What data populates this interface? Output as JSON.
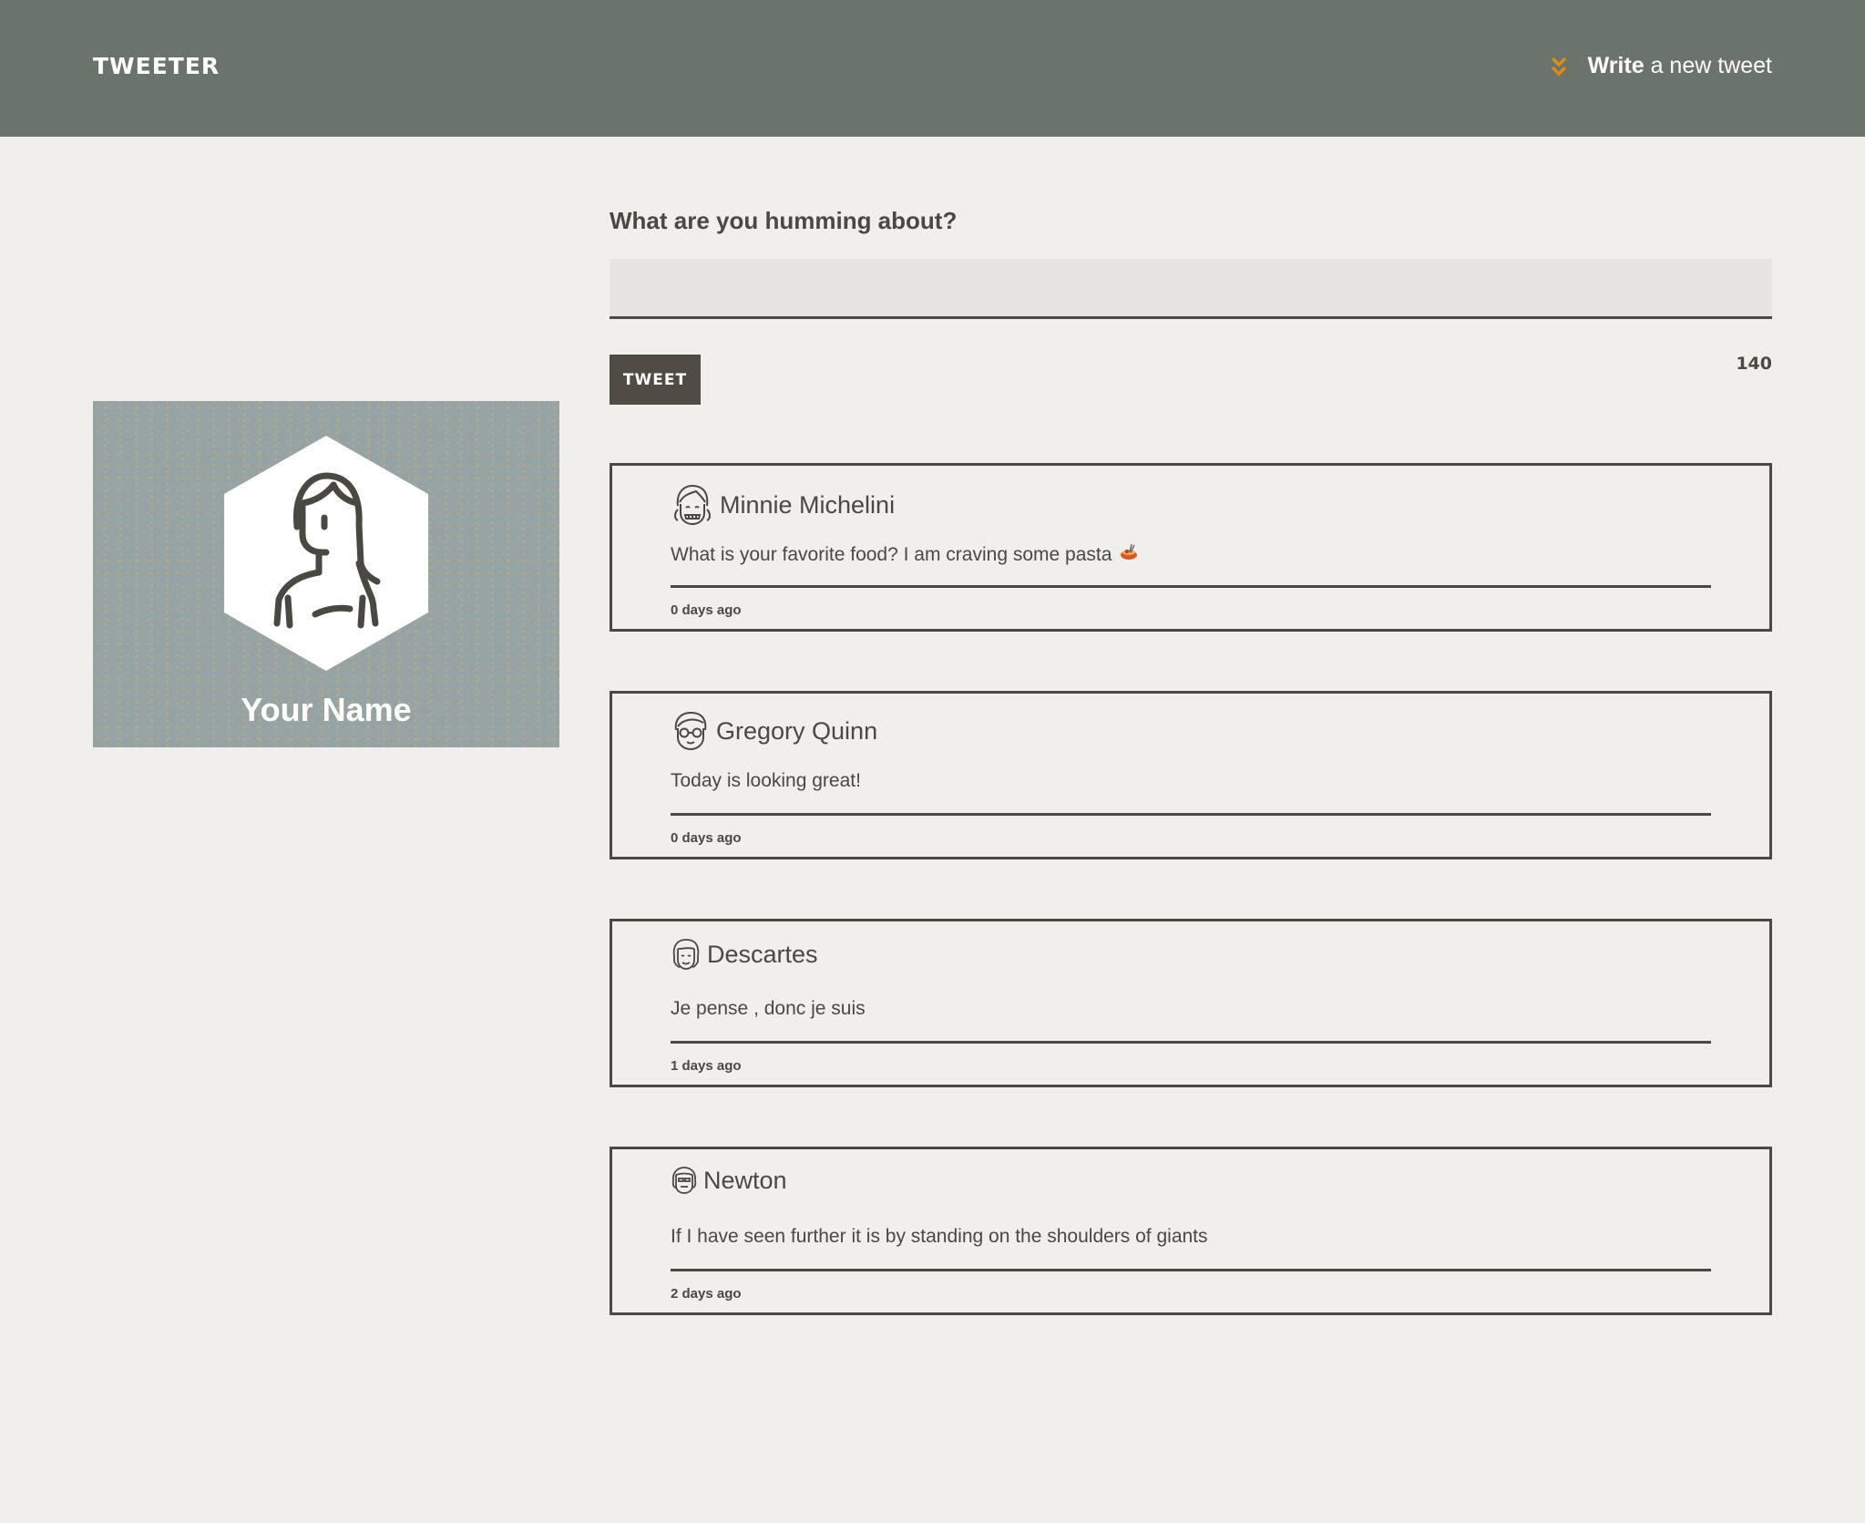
{
  "header": {
    "brand": "TWEETER",
    "compose_strong": "Write",
    "compose_rest": "a new tweet",
    "accent": "#d98b1c"
  },
  "profile": {
    "name": "Your Name"
  },
  "compose": {
    "label": "What are you humming about?",
    "value": "",
    "button_label": "TWEET",
    "char_count": "140"
  },
  "tweets": [
    {
      "author": "Minnie Michelini",
      "avatar": "girl-avatar-icon",
      "text": "What is your favorite food? I am craving some pasta",
      "emoji": "pasta-emoji",
      "time": "0 days ago"
    },
    {
      "author": "Gregory Quinn",
      "avatar": "boy-glasses-avatar-icon",
      "text": "Today is looking great!",
      "time": "0 days ago"
    },
    {
      "author": "Descartes",
      "avatar": "philosopher-avatar-icon",
      "text": "Je pense , donc je suis",
      "time": "1 days ago"
    },
    {
      "author": "Newton",
      "avatar": "scientist-avatar-icon",
      "text": "If I have seen further it is by standing on the shoulders of giants",
      "time": "2 days ago"
    }
  ],
  "colors": {
    "header_bg": "#6a746a",
    "page_bg": "#f0efeb",
    "text": "#4a4840",
    "profile_bg": "#95a3a4"
  }
}
